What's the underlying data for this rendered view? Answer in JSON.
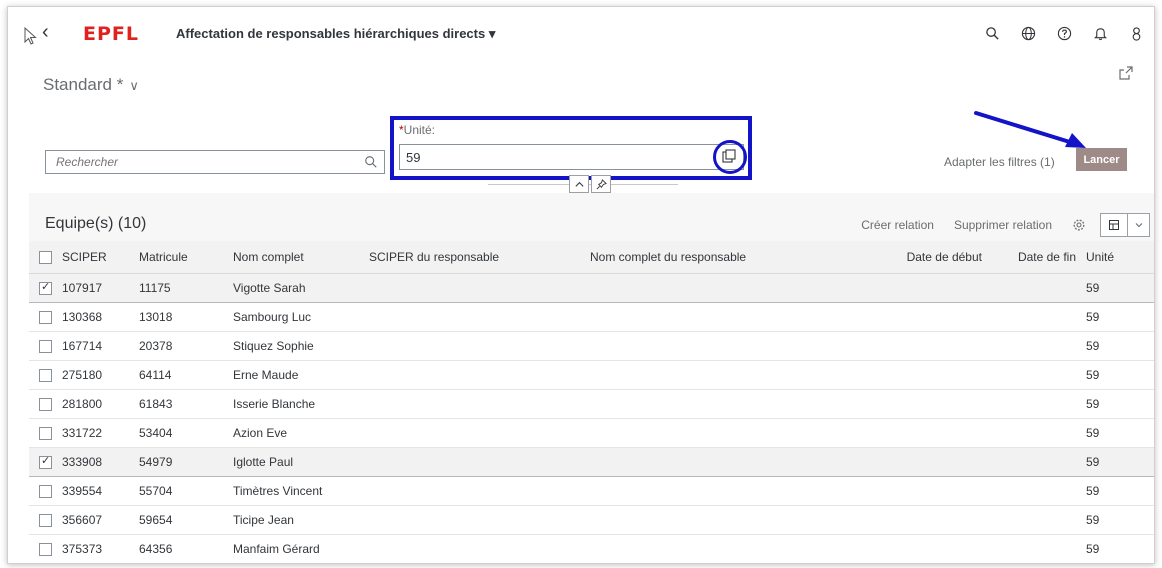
{
  "shell": {
    "app_title": "Affectation de responsables hiérarchiques directs ▾",
    "logo_text": "EPFL",
    "icons": [
      "search-icon",
      "globe-icon",
      "help-icon",
      "bell-icon",
      "user-icon"
    ]
  },
  "variant": {
    "name": "Standard *"
  },
  "filters": {
    "search_placeholder": "Rechercher",
    "unit_label": "Unité:",
    "unit_required_mark": "*",
    "unit_value": "59",
    "adapt_label": "Adapter les filtres (1)",
    "go_label": "Lancer"
  },
  "table": {
    "title": "Equipe(s) (10)",
    "create_label": "Créer relation",
    "delete_label": "Supprimer relation",
    "columns": [
      "SCIPER",
      "Matricule",
      "Nom complet",
      "SCIPER du responsable",
      "Nom complet du responsable",
      "Date de début",
      "Date de fin",
      "Unité"
    ],
    "rows": [
      {
        "selected": true,
        "sciper": "107917",
        "matricule": "11175",
        "nom": "Vigotte Sarah",
        "unite": "59"
      },
      {
        "selected": false,
        "sciper": "130368",
        "matricule": "13018",
        "nom": "Sambourg Luc",
        "unite": "59"
      },
      {
        "selected": false,
        "sciper": "167714",
        "matricule": "20378",
        "nom": "Stiquez Sophie",
        "unite": "59"
      },
      {
        "selected": false,
        "sciper": "275180",
        "matricule": "64114",
        "nom": "Erne Maude",
        "unite": "59"
      },
      {
        "selected": false,
        "sciper": "281800",
        "matricule": "61843",
        "nom": "Isserie Blanche",
        "unite": "59"
      },
      {
        "selected": false,
        "sciper": "331722",
        "matricule": "53404",
        "nom": "Azion Eve",
        "unite": "59"
      },
      {
        "selected": true,
        "sciper": "333908",
        "matricule": "54979",
        "nom": "Iglotte Paul",
        "unite": "59"
      },
      {
        "selected": false,
        "sciper": "339554",
        "matricule": "55704",
        "nom": "Timètres Vincent",
        "unite": "59"
      },
      {
        "selected": false,
        "sciper": "356607",
        "matricule": "59654",
        "nom": "Ticipe Jean",
        "unite": "59"
      },
      {
        "selected": false,
        "sciper": "375373",
        "matricule": "64356",
        "nom": "Manfaim Gérard",
        "unite": "59"
      }
    ]
  },
  "colors": {
    "brand": "#e1211f",
    "annotation": "#1313c8",
    "go_button": "#9e8a87"
  }
}
